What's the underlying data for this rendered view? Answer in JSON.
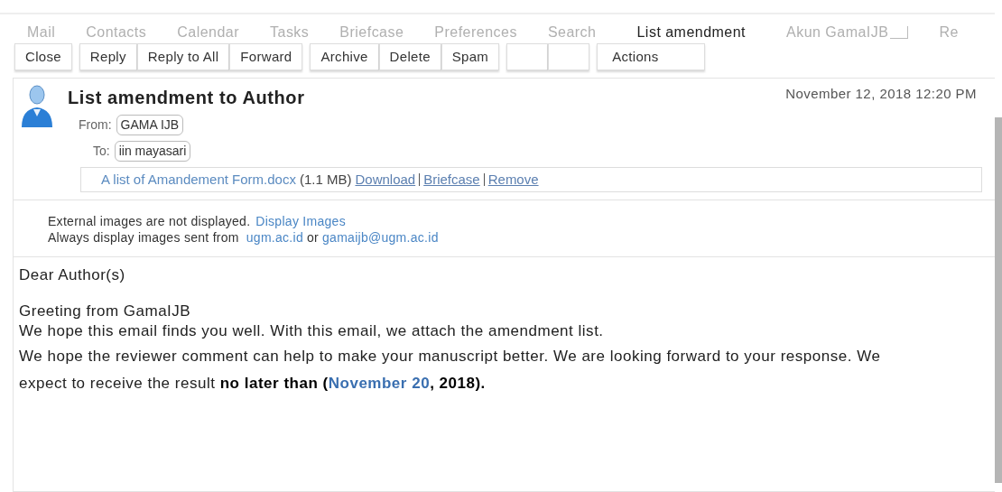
{
  "tabs": [
    {
      "label": "Mail",
      "selected": false
    },
    {
      "label": "Contacts",
      "selected": false
    },
    {
      "label": "Calendar",
      "selected": false
    },
    {
      "label": "Tasks",
      "selected": false
    },
    {
      "label": "Briefcase",
      "selected": false
    },
    {
      "label": "Preferences",
      "selected": false
    },
    {
      "label": "Search",
      "selected": false
    },
    {
      "label": "List amendment",
      "selected": true
    },
    {
      "label": "Akun GamaIJB",
      "selected": false
    },
    {
      "label": "Re",
      "selected": false
    }
  ],
  "toolbar": [
    [
      {
        "kind": "text",
        "label": "Close"
      }
    ],
    [
      {
        "kind": "text",
        "label": "Reply"
      },
      {
        "kind": "text",
        "label": "Reply to All"
      },
      {
        "kind": "text",
        "label": "Forward"
      }
    ],
    [
      {
        "kind": "text",
        "label": "Archive"
      },
      {
        "kind": "text",
        "label": "Delete"
      },
      {
        "kind": "text",
        "label": "Spam"
      }
    ],
    [
      {
        "kind": "blank"
      },
      {
        "kind": "blank"
      }
    ],
    [
      {
        "kind": "menu",
        "label": "Actions"
      }
    ]
  ],
  "message": {
    "subject": "List amendment to Author",
    "date": "November 12, 2018 12:20 PM",
    "from_label": "From:",
    "from": "GAMA IJB",
    "to_label": "To:",
    "to": "iin mayasari",
    "attachment": {
      "name": "A list of Amandement Form.docx",
      "size": "(1.1 MB)",
      "links": [
        "Download",
        "Briefcase",
        "Remove"
      ]
    },
    "images_notice": {
      "text": "External images are not displayed.",
      "link": "Display Images",
      "always_text": "Always display images sent from",
      "domain": "ugm.ac.id",
      "or": "or",
      "address": "gamaijb@ugm.ac.id"
    },
    "body": [
      "Dear Author(s)",
      "Greeting from GamaIJB",
      "We hope this email finds you well. With this email, we attach the amendment list.",
      "We hope the reviewer comment can help to make your manuscript better. We are looking forward to your response. We"
    ],
    "closing": [
      {
        "text": "expect to receive the result ",
        "kind": "plain"
      },
      {
        "text": "no later than (",
        "kind": "bold"
      },
      {
        "text": "November 20",
        "kind": "highlight"
      },
      {
        "text": ", 2018).",
        "kind": "bold"
      }
    ]
  }
}
